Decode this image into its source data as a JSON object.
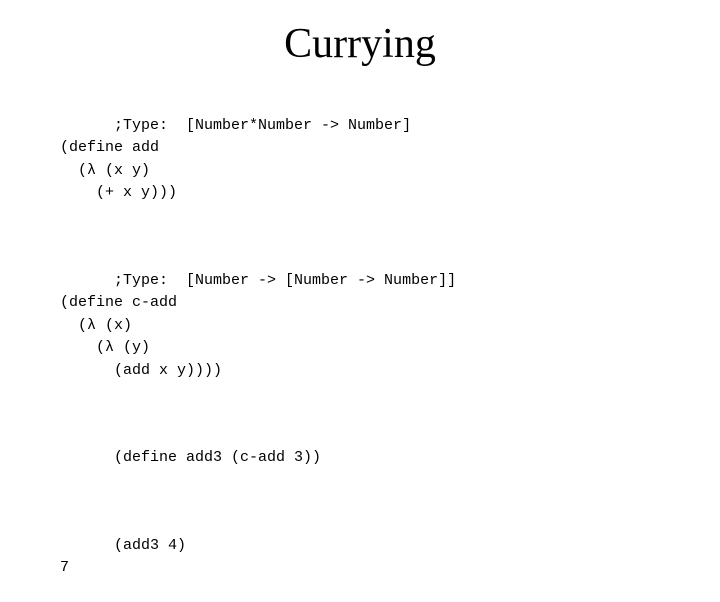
{
  "page": {
    "title": "Currying",
    "background": "#ffffff"
  },
  "sections": [
    {
      "id": "section1",
      "lines": [
        ";Type:  [Number*Number -> Number]",
        "(define add",
        "  (λ (x y)",
        "    (+ x y)))"
      ]
    },
    {
      "id": "section2",
      "lines": [
        ";Type:  [Number -> [Number -> Number]]",
        "(define c-add",
        "  (λ (x)",
        "    (λ (y)",
        "      (add x y))))"
      ]
    },
    {
      "id": "section3",
      "lines": [
        "(define add3 (c-add 3))"
      ]
    },
    {
      "id": "section4",
      "lines": [
        "(add3 4)",
        "7"
      ]
    }
  ]
}
